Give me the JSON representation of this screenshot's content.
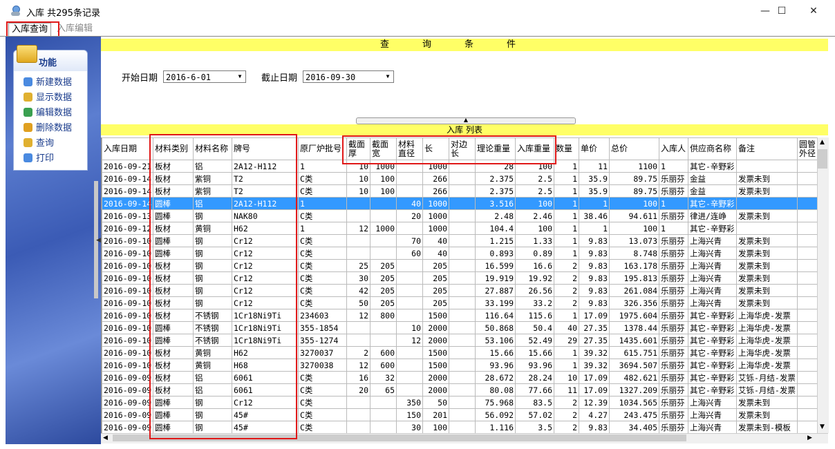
{
  "window": {
    "title": "入库 共295条记录",
    "minimize": "—",
    "maximize": "☐",
    "close": "✕"
  },
  "tabs": [
    {
      "label": "入库查询"
    },
    {
      "label": "入库编辑"
    }
  ],
  "sidebar": {
    "title": "功能",
    "items": [
      {
        "label": "新建数据",
        "icon": "new-data-icon",
        "color": "#4a8ae0"
      },
      {
        "label": "显示数据",
        "icon": "show-data-icon",
        "color": "#e0b030"
      },
      {
        "label": "编辑数据",
        "icon": "edit-data-icon",
        "color": "#3aa050"
      },
      {
        "label": "删除数据",
        "icon": "delete-data-icon",
        "color": "#e0a020"
      },
      {
        "label": "查询",
        "icon": "query-icon",
        "color": "#e0b030"
      },
      {
        "label": "打印",
        "icon": "print-icon",
        "color": "#4a8ae0"
      }
    ]
  },
  "query": {
    "header": "查询条件",
    "start_label": "开始日期",
    "start_value": "2016-6-01",
    "end_label": "截止日期",
    "end_value": "2016-09-30"
  },
  "list": {
    "header": "入库 列表",
    "columns": [
      "入库日期",
      "材料类别",
      "材料名称",
      "牌号",
      "原厂炉批号",
      "截面厚",
      "截面宽",
      "材料直径",
      "长",
      "对边长",
      "理论重量",
      "入库重量",
      "数量",
      "单价",
      "总价",
      "入库人",
      "供应商名称",
      "备注",
      "圆管外径"
    ],
    "rows": [
      [
        "2016-09-21",
        "板材",
        "铝",
        "2A12-H112",
        "1",
        "10",
        "1000",
        "",
        "1000",
        "",
        "28",
        "100",
        "1",
        "11",
        "1100",
        "1",
        "其它-辛野彩",
        "",
        ""
      ],
      [
        "2016-09-14",
        "板材",
        "紫铜",
        "T2",
        "C类",
        "10",
        "100",
        "",
        "266",
        "",
        "2.375",
        "2.5",
        "1",
        "35.9",
        "89.75",
        "乐丽芬",
        "金益",
        "发票未到",
        ""
      ],
      [
        "2016-09-14",
        "板材",
        "紫铜",
        "T2",
        "C类",
        "10",
        "100",
        "",
        "266",
        "",
        "2.375",
        "2.5",
        "1",
        "35.9",
        "89.75",
        "乐丽芬",
        "金益",
        "发票未到",
        ""
      ],
      [
        "2016-09-14",
        "圆棒",
        "铝",
        "2A12-H112",
        "1",
        "",
        "",
        "40",
        "1000",
        "",
        "3.516",
        "100",
        "1",
        "1",
        "100",
        "1",
        "其它-辛野彩",
        "",
        ""
      ],
      [
        "2016-09-13",
        "圆棒",
        "钢",
        "NAK80",
        "C类",
        "",
        "",
        "20",
        "1000",
        "",
        "2.48",
        "2.46",
        "1",
        "38.46",
        "94.611",
        "乐丽芬",
        "律进/连峥",
        "发票未到",
        ""
      ],
      [
        "2016-09-12",
        "板材",
        "黄铜",
        "H62",
        "1",
        "12",
        "1000",
        "",
        "1000",
        "",
        "104.4",
        "100",
        "1",
        "1",
        "100",
        "1",
        "其它-辛野彩",
        "",
        ""
      ],
      [
        "2016-09-10",
        "圆棒",
        "钢",
        "Cr12",
        "C类",
        "",
        "",
        "70",
        "40",
        "",
        "1.215",
        "1.33",
        "1",
        "9.83",
        "13.073",
        "乐丽芬",
        "上海兴青",
        "发票未到",
        ""
      ],
      [
        "2016-09-10",
        "圆棒",
        "钢",
        "Cr12",
        "C类",
        "",
        "",
        "60",
        "40",
        "",
        "0.893",
        "0.89",
        "1",
        "9.83",
        "8.748",
        "乐丽芬",
        "上海兴青",
        "发票未到",
        ""
      ],
      [
        "2016-09-10",
        "板材",
        "钢",
        "Cr12",
        "C类",
        "25",
        "205",
        "",
        "205",
        "",
        "16.599",
        "16.6",
        "2",
        "9.83",
        "163.178",
        "乐丽芬",
        "上海兴青",
        "发票未到",
        ""
      ],
      [
        "2016-09-10",
        "板材",
        "钢",
        "Cr12",
        "C类",
        "30",
        "205",
        "",
        "205",
        "",
        "19.919",
        "19.92",
        "2",
        "9.83",
        "195.813",
        "乐丽芬",
        "上海兴青",
        "发票未到",
        ""
      ],
      [
        "2016-09-10",
        "板材",
        "钢",
        "Cr12",
        "C类",
        "42",
        "205",
        "",
        "205",
        "",
        "27.887",
        "26.56",
        "2",
        "9.83",
        "261.084",
        "乐丽芬",
        "上海兴青",
        "发票未到",
        ""
      ],
      [
        "2016-09-10",
        "板材",
        "钢",
        "Cr12",
        "C类",
        "50",
        "205",
        "",
        "205",
        "",
        "33.199",
        "33.2",
        "2",
        "9.83",
        "326.356",
        "乐丽芬",
        "上海兴青",
        "发票未到",
        ""
      ],
      [
        "2016-09-10",
        "板材",
        "不锈钢",
        "1Cr18Ni9Ti",
        "234603",
        "12",
        "800",
        "",
        "1500",
        "",
        "116.64",
        "115.6",
        "1",
        "17.09",
        "1975.604",
        "乐丽芬",
        "其它-辛野彩",
        "上海华虎-发票",
        ""
      ],
      [
        "2016-09-10",
        "圆棒",
        "不锈钢",
        "1Cr18Ni9Ti",
        "355-1854",
        "",
        "",
        "10",
        "2000",
        "",
        "50.868",
        "50.4",
        "40",
        "27.35",
        "1378.44",
        "乐丽芬",
        "其它-辛野彩",
        "上海华虎-发票",
        ""
      ],
      [
        "2016-09-10",
        "圆棒",
        "不锈钢",
        "1Cr18Ni9Ti",
        "355-1274",
        "",
        "",
        "12",
        "2000",
        "",
        "53.106",
        "52.49",
        "29",
        "27.35",
        "1435.601",
        "乐丽芬",
        "其它-辛野彩",
        "上海华虎-发票",
        ""
      ],
      [
        "2016-09-10",
        "板材",
        "黄铜",
        "H62",
        "3270037",
        "2",
        "600",
        "",
        "1500",
        "",
        "15.66",
        "15.66",
        "1",
        "39.32",
        "615.751",
        "乐丽芬",
        "其它-辛野彩",
        "上海华虎-发票",
        ""
      ],
      [
        "2016-09-10",
        "板材",
        "黄铜",
        "H68",
        "3270038",
        "12",
        "600",
        "",
        "1500",
        "",
        "93.96",
        "93.96",
        "1",
        "39.32",
        "3694.507",
        "乐丽芬",
        "其它-辛野彩",
        "上海华虎-发票",
        ""
      ],
      [
        "2016-09-09",
        "板材",
        "铝",
        "6061",
        "C类",
        "16",
        "32",
        "",
        "2000",
        "",
        "28.672",
        "28.24",
        "10",
        "17.09",
        "482.621",
        "乐丽芬",
        "其它-辛野彩",
        "艾铄-月结-发票",
        ""
      ],
      [
        "2016-09-09",
        "板材",
        "铝",
        "6061",
        "C类",
        "20",
        "65",
        "",
        "2000",
        "",
        "80.08",
        "77.66",
        "11",
        "17.09",
        "1327.209",
        "乐丽芬",
        "其它-辛野彩",
        "艾铄-月结-发票",
        ""
      ],
      [
        "2016-09-09",
        "圆棒",
        "钢",
        "Cr12",
        "C类",
        "",
        "",
        "350",
        "50",
        "",
        "75.968",
        "83.5",
        "2",
        "12.39",
        "1034.565",
        "乐丽芬",
        "上海兴青",
        "发票未到",
        ""
      ],
      [
        "2016-09-09",
        "圆棒",
        "钢",
        "45#",
        "C类",
        "",
        "",
        "150",
        "201",
        "",
        "56.092",
        "57.02",
        "2",
        "4.27",
        "243.475",
        "乐丽芬",
        "上海兴青",
        "发票未到",
        ""
      ],
      [
        "2016-09-09",
        "圆棒",
        "钢",
        "45#",
        "C类",
        "",
        "",
        "30",
        "100",
        "",
        "1.116",
        "3.5",
        "2",
        "9.83",
        "34.405",
        "乐丽芬",
        "上海兴青",
        "发票未到-模板",
        ""
      ]
    ],
    "selected_row": 3
  }
}
